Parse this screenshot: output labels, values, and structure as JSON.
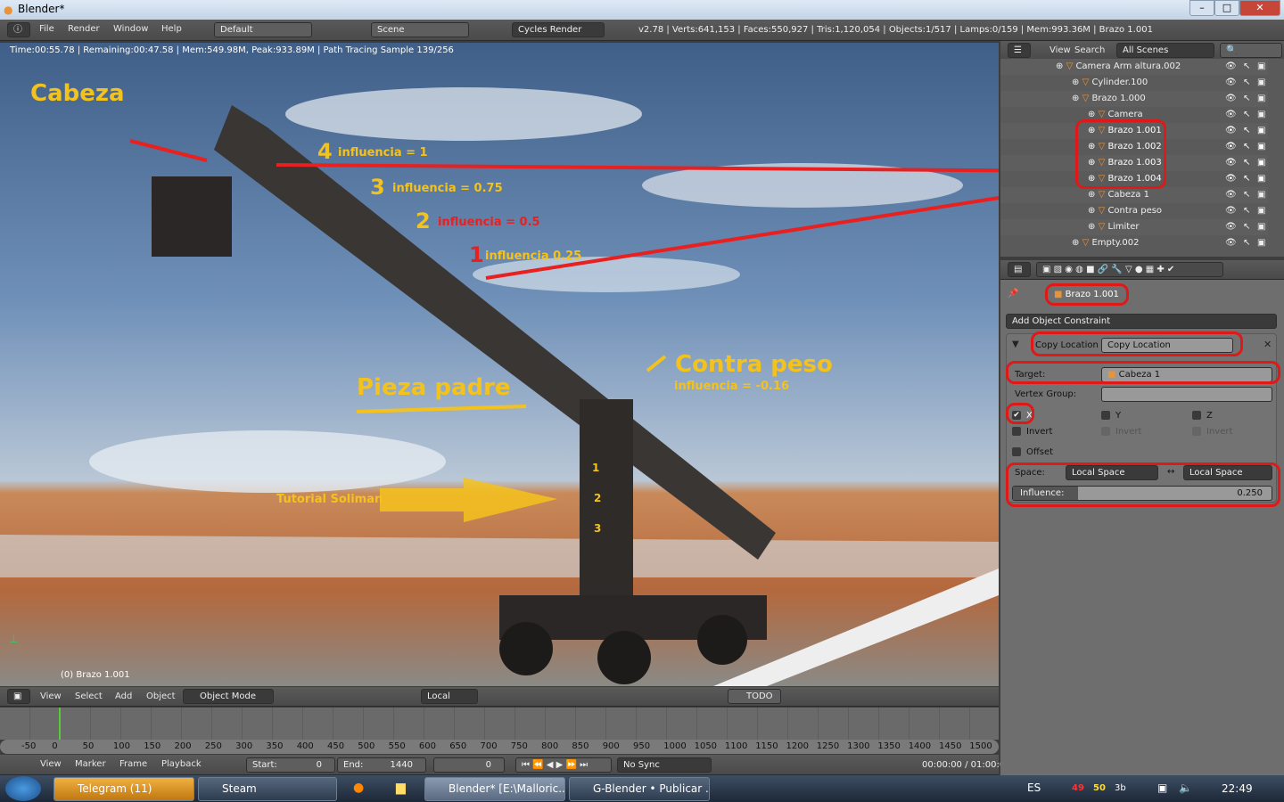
{
  "window": {
    "title": "Blender*",
    "min": "–",
    "max": "□",
    "close": "✕"
  },
  "infobar": {
    "menus": [
      "File",
      "Render",
      "Window",
      "Help"
    ],
    "layout": "Default",
    "scene": "Scene",
    "engine": "Cycles Render",
    "stats": "v2.78 | Verts:641,153 | Faces:550,927 | Tris:1,120,054 | Objects:1/517 | Lamps:0/159 | Mem:993.36M | Brazo 1.001"
  },
  "viewport": {
    "render_info": "Time:00:55.78 | Remaining:00:47.58 | Mem:549.98M, Peak:933.89M | Path Tracing Sample 139/256",
    "object_label": "(0) Brazo 1.001",
    "annotations": {
      "cabeza": "Cabeza",
      "n4": "4",
      "i4": "influencia = 1",
      "n3": "3",
      "i3": "influencia = 0.75",
      "n2": "2",
      "i2": "influencia = 0.5",
      "n1": "1",
      "i1": "influencia 0.25",
      "contra": "Contra peso",
      "contra_inf": "influencia =  -0.16",
      "pieza": "Pieza padre",
      "tutorial": "Tutorial Soliman",
      "p1": "1",
      "p2": "2",
      "p3": "3"
    },
    "header": {
      "menus": [
        "View",
        "Select",
        "Add",
        "Object"
      ],
      "mode": "Object Mode",
      "orientation": "Local",
      "todo": "TODO"
    }
  },
  "outliner": {
    "menus": [
      "View",
      "Search"
    ],
    "filter": "All Scenes",
    "items": [
      {
        "name": "Camera Arm altura.002",
        "indent": 0
      },
      {
        "name": "Cylinder.100",
        "indent": 1
      },
      {
        "name": "Brazo 1.000",
        "indent": 1
      },
      {
        "name": "Camera",
        "indent": 2
      },
      {
        "name": "Brazo 1.001",
        "indent": 2
      },
      {
        "name": "Brazo 1.002",
        "indent": 2
      },
      {
        "name": "Brazo 1.003",
        "indent": 2
      },
      {
        "name": "Brazo 1.004",
        "indent": 2
      },
      {
        "name": "Cabeza 1",
        "indent": 2
      },
      {
        "name": "Contra peso",
        "indent": 2
      },
      {
        "name": "Limiter",
        "indent": 2
      },
      {
        "name": "Empty.002",
        "indent": 1
      }
    ]
  },
  "properties": {
    "object": "Brazo 1.001",
    "add_constraint": "Add Object Constraint",
    "constraint_type": "Copy Location",
    "constraint_name": "Copy Location",
    "target_label": "Target:",
    "target": "Cabeza 1",
    "vgroup_label": "Vertex Group:",
    "x": "X",
    "y": "Y",
    "z": "Z",
    "invert": "Invert",
    "offset": "Offset",
    "x_checked": true,
    "space_label": "Space:",
    "space_owner": "Local Space",
    "space_target": "Local Space",
    "arrow": "↔",
    "influence_label": "Influence:",
    "influence": "0.250",
    "influence_value": 0.25
  },
  "timeline": {
    "ticks": [
      "-50",
      "0",
      "50",
      "100",
      "150",
      "200",
      "250",
      "300",
      "350",
      "400",
      "450",
      "500",
      "550",
      "600",
      "650",
      "700",
      "750",
      "800",
      "850",
      "900",
      "950",
      "1000",
      "1050",
      "1100",
      "1150",
      "1200",
      "1250",
      "1300",
      "1350",
      "1400",
      "1450",
      "1500"
    ],
    "menus": [
      "View",
      "Marker",
      "Frame",
      "Playback"
    ],
    "start_label": "Start:",
    "start": "0",
    "end_label": "End:",
    "end": "1440",
    "current": "0",
    "sync": "No Sync",
    "time": "00:00:00 / 01:00:0"
  },
  "taskbar": {
    "items": [
      "Telegram (11)",
      "Steam",
      "Blender* [E:\\Malloric...",
      "G-Blender • Publicar ..."
    ],
    "lang": "ES",
    "tray": [
      "49",
      "50",
      "3b"
    ],
    "clock": "22:49"
  },
  "colors": {
    "annotation_yellow": "#f4c21c",
    "annotation_red": "#e82020",
    "header": "#4a4a4a"
  }
}
